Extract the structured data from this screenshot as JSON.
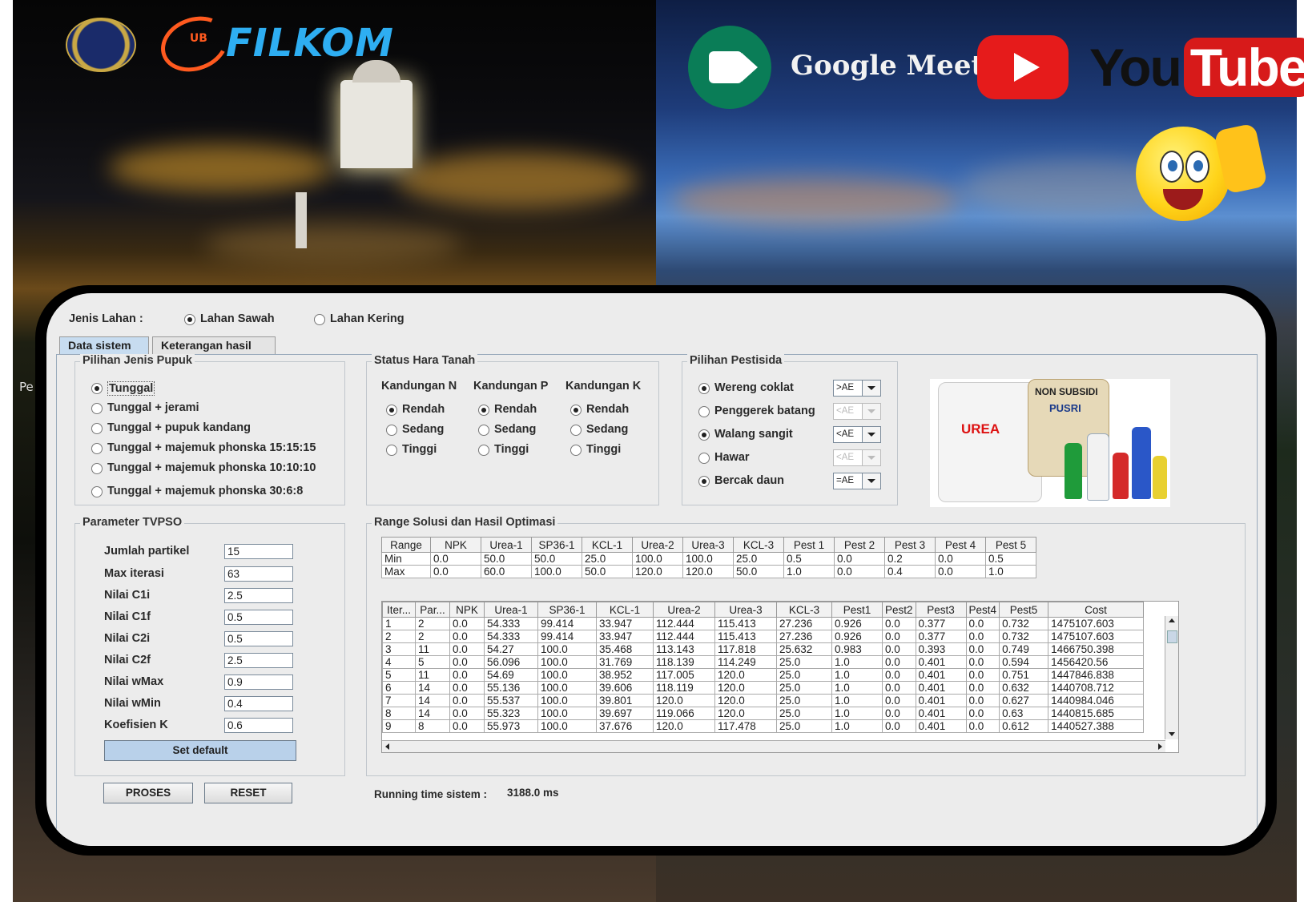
{
  "banner": {
    "brand_ub": "UB",
    "brand_filkom": "FILKOM",
    "meet_label": "Google Meet",
    "youtube_you": "You",
    "youtube_tube": "Tube",
    "left_edge_text": "Pe"
  },
  "jenis_lahan": {
    "label": "Jenis Lahan  :",
    "options": [
      {
        "label": "Lahan Sawah",
        "selected": true
      },
      {
        "label": "Lahan Kering",
        "selected": false
      }
    ]
  },
  "tabs": [
    {
      "label": "Data sistem",
      "active": true
    },
    {
      "label": "Keterangan hasil",
      "active": false
    }
  ],
  "pupuk": {
    "title": "Pilihan Jenis Pupuk",
    "options": [
      {
        "label": "Tunggal",
        "selected": true
      },
      {
        "label": "Tunggal + jerami",
        "selected": false
      },
      {
        "label": "Tunggal + pupuk kandang",
        "selected": false
      },
      {
        "label": "Tunggal + majemuk phonska 15:15:15",
        "selected": false
      },
      {
        "label": "Tunggal + majemuk phonska 10:10:10",
        "selected": false
      },
      {
        "label": "Tunggal + majemuk phonska 30:6:8",
        "selected": false
      }
    ]
  },
  "hara": {
    "title": "Status Hara Tanah",
    "columns": [
      {
        "header": "Kandungan N",
        "options": [
          "Rendah",
          "Sedang",
          "Tinggi"
        ],
        "selected": 0
      },
      {
        "header": "Kandungan P",
        "options": [
          "Rendah",
          "Sedang",
          "Tinggi"
        ],
        "selected": 0
      },
      {
        "header": "Kandungan K",
        "options": [
          "Rendah",
          "Sedang",
          "Tinggi"
        ],
        "selected": 0
      }
    ]
  },
  "pestisida": {
    "title": "Pilihan Pestisida",
    "items": [
      {
        "label": "Wereng coklat",
        "selected": true,
        "combo": ">AE",
        "enabled": true
      },
      {
        "label": "Penggerek batang",
        "selected": false,
        "combo": "<AE",
        "enabled": false
      },
      {
        "label": "Walang sangit",
        "selected": true,
        "combo": "<AE",
        "enabled": true
      },
      {
        "label": "Hawar",
        "selected": false,
        "combo": "<AE",
        "enabled": false
      },
      {
        "label": "Bercak daun",
        "selected": true,
        "combo": "=AE",
        "enabled": true
      }
    ]
  },
  "tvpso": {
    "title": "Parameter TVPSO",
    "params": [
      {
        "label": "Jumlah partikel",
        "value": "15"
      },
      {
        "label": "Max iterasi",
        "value": "63"
      },
      {
        "label": "Nilai C1i",
        "value": "2.5"
      },
      {
        "label": "Nilai C1f",
        "value": "0.5"
      },
      {
        "label": "Nilai C2i",
        "value": "0.5"
      },
      {
        "label": "Nilai C2f",
        "value": "2.5"
      },
      {
        "label": "Nilai wMax",
        "value": "0.9"
      },
      {
        "label": "Nilai wMin",
        "value": "0.4"
      },
      {
        "label": "Koefisien K",
        "value": "0.6"
      }
    ],
    "set_default": "Set default"
  },
  "buttons": {
    "proses": "PROSES",
    "reset": "RESET"
  },
  "range": {
    "title": "Range Solusi dan Hasil Optimasi",
    "headers": [
      "Range",
      "NPK",
      "Urea-1",
      "SP36-1",
      "KCL-1",
      "Urea-2",
      "Urea-3",
      "KCL-3",
      "Pest 1",
      "Pest 2",
      "Pest 3",
      "Pest 4",
      "Pest 5"
    ],
    "rows": [
      [
        "Min",
        "0.0",
        "50.0",
        "50.0",
        "25.0",
        "100.0",
        "100.0",
        "25.0",
        "0.5",
        "0.0",
        "0.2",
        "0.0",
        "0.5"
      ],
      [
        "Max",
        "0.0",
        "60.0",
        "100.0",
        "50.0",
        "120.0",
        "120.0",
        "50.0",
        "1.0",
        "0.0",
        "0.4",
        "0.0",
        "1.0"
      ]
    ]
  },
  "hasil": {
    "headers": [
      "Iter...",
      "Par...",
      "NPK",
      "Urea-1",
      "SP36-1",
      "KCL-1",
      "Urea-2",
      "Urea-3",
      "KCL-3",
      "Pest1",
      "Pest2",
      "Pest3",
      "Pest4",
      "Pest5",
      "Cost"
    ],
    "rows": [
      [
        "1",
        "2",
        "0.0",
        "54.333",
        "99.414",
        "33.947",
        "112.444",
        "115.413",
        "27.236",
        "0.926",
        "0.0",
        "0.377",
        "0.0",
        "0.732",
        "1475107.603"
      ],
      [
        "2",
        "2",
        "0.0",
        "54.333",
        "99.414",
        "33.947",
        "112.444",
        "115.413",
        "27.236",
        "0.926",
        "0.0",
        "0.377",
        "0.0",
        "0.732",
        "1475107.603"
      ],
      [
        "3",
        "11",
        "0.0",
        "54.27",
        "100.0",
        "35.468",
        "113.143",
        "117.818",
        "25.632",
        "0.983",
        "0.0",
        "0.393",
        "0.0",
        "0.749",
        "1466750.398"
      ],
      [
        "4",
        "5",
        "0.0",
        "56.096",
        "100.0",
        "31.769",
        "118.139",
        "114.249",
        "25.0",
        "1.0",
        "0.0",
        "0.401",
        "0.0",
        "0.594",
        "1456420.56"
      ],
      [
        "5",
        "11",
        "0.0",
        "54.69",
        "100.0",
        "38.952",
        "117.005",
        "120.0",
        "25.0",
        "1.0",
        "0.0",
        "0.401",
        "0.0",
        "0.751",
        "1447846.838"
      ],
      [
        "6",
        "14",
        "0.0",
        "55.136",
        "100.0",
        "39.606",
        "118.119",
        "120.0",
        "25.0",
        "1.0",
        "0.0",
        "0.401",
        "0.0",
        "0.632",
        "1440708.712"
      ],
      [
        "7",
        "14",
        "0.0",
        "55.537",
        "100.0",
        "39.801",
        "120.0",
        "120.0",
        "25.0",
        "1.0",
        "0.0",
        "0.401",
        "0.0",
        "0.627",
        "1440984.046"
      ],
      [
        "8",
        "14",
        "0.0",
        "55.323",
        "100.0",
        "39.697",
        "119.066",
        "120.0",
        "25.0",
        "1.0",
        "0.0",
        "0.401",
        "0.0",
        "0.63",
        "1440815.685"
      ],
      [
        "9",
        "8",
        "0.0",
        "55.973",
        "100.0",
        "37.676",
        "120.0",
        "117.478",
        "25.0",
        "1.0",
        "0.0",
        "0.401",
        "0.0",
        "0.612",
        "1440527.388"
      ]
    ]
  },
  "running": {
    "label": "Running time sistem :",
    "value": "3188.0 ms"
  },
  "product_image": {
    "sack_label": "UREA",
    "sack_brand": "PUSRI",
    "sack_tag": "NON SUBSIDI"
  }
}
